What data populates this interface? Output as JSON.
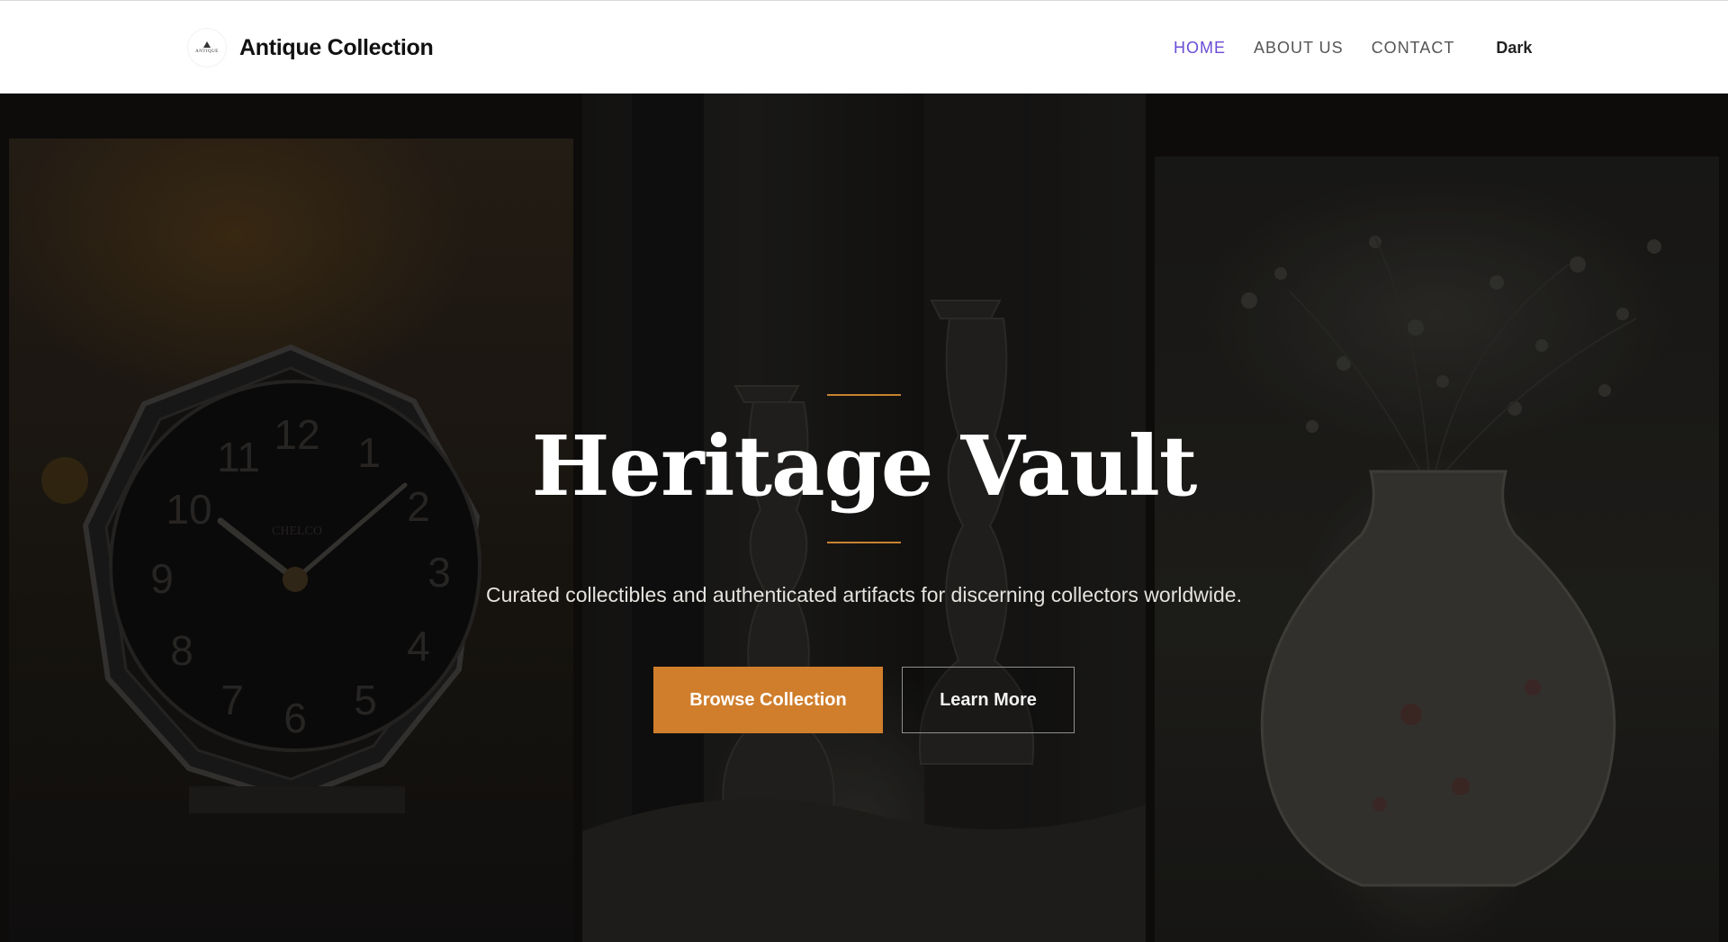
{
  "header": {
    "brand_name": "Antique Collection",
    "logo_text": "ANTIQUE",
    "nav": [
      {
        "label": "HOME",
        "active": true
      },
      {
        "label": "ABOUT US",
        "active": false
      },
      {
        "label": "CONTACT",
        "active": false
      }
    ],
    "theme_toggle_label": "Dark"
  },
  "hero": {
    "title": "Heritage Vault",
    "subtitle": "Curated collectibles and authenticated artifacts for discerning collectors worldwide.",
    "primary_button": "Browse Collection",
    "secondary_button": "Learn More",
    "clock_brand": "CHELCO",
    "clock_numerals": [
      "12",
      "1",
      "2",
      "3",
      "4",
      "5",
      "6",
      "7",
      "8",
      "9",
      "10",
      "11"
    ]
  },
  "colors": {
    "accent": "#d07e2c",
    "nav_active": "#6a4cd6",
    "hero_background": "#0f0e0c",
    "header_background": "#ffffff"
  }
}
